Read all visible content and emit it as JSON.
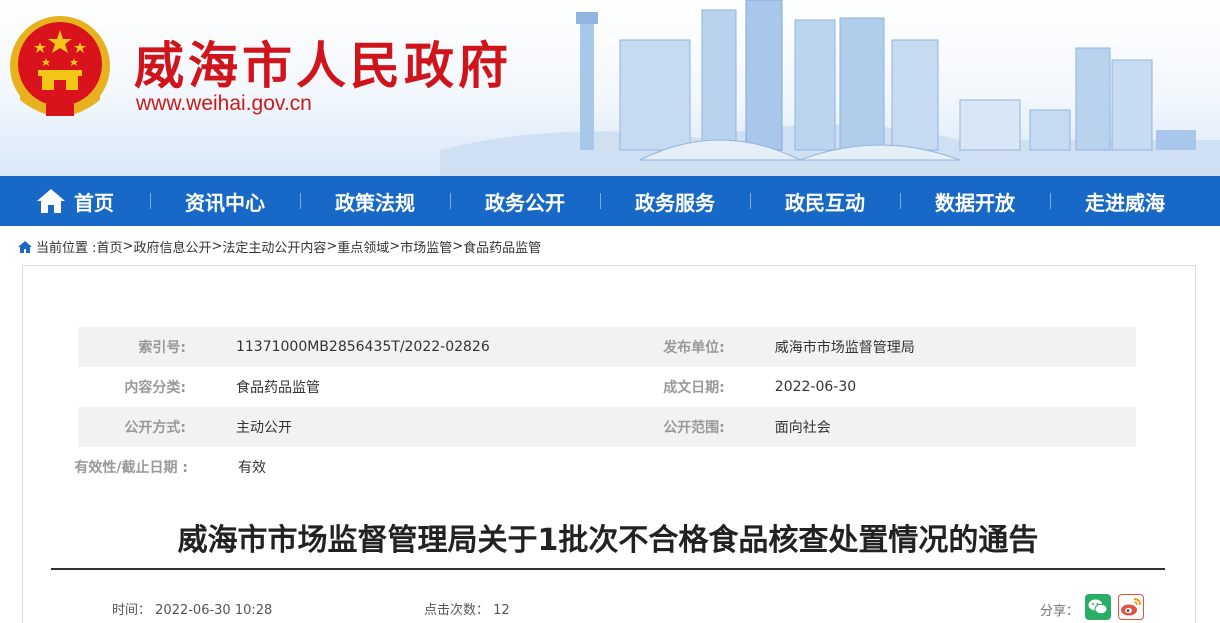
{
  "header": {
    "site_title": "威海市人民政府",
    "site_url": "www.weihai.gov.cn",
    "title_color": "#d0141b"
  },
  "nav": {
    "accent": "#1868c8",
    "items": [
      {
        "label": "首页",
        "icon": "home-icon"
      },
      {
        "label": "资讯中心"
      },
      {
        "label": "政策法规"
      },
      {
        "label": "政务公开"
      },
      {
        "label": "政务服务"
      },
      {
        "label": "政民互动"
      },
      {
        "label": "数据开放"
      },
      {
        "label": "走进威海"
      }
    ]
  },
  "breadcrumb": {
    "prefix": "当前位置 :",
    "items": [
      "首页",
      "政府信息公开",
      "法定主动公开内容",
      "重点领域",
      "市场监管",
      "食品药品监管"
    ],
    "sep": ">"
  },
  "meta": {
    "index_no_label": "索引号:",
    "index_no": "11371000MB2856435T/2022-02826",
    "publisher_label": "发布单位:",
    "publisher": "威海市市场监督管理局",
    "category_label": "内容分类:",
    "category": "食品药品监管",
    "date_label": "成文日期:",
    "date": "2022-06-30",
    "mode_label": "公开方式:",
    "mode": "主动公开",
    "scope_label": "公开范围:",
    "scope": "面向社会",
    "validity_label": "有效性/截止日期 :",
    "validity": "有效"
  },
  "article": {
    "title": "威海市市场监督管理局关于1批次不合格食品核查处置情况的通告",
    "time_label": "时间：",
    "time": "2022-06-30 10:28",
    "clicks_label": "点击次数：",
    "clicks": "12",
    "share_label": "分享："
  }
}
